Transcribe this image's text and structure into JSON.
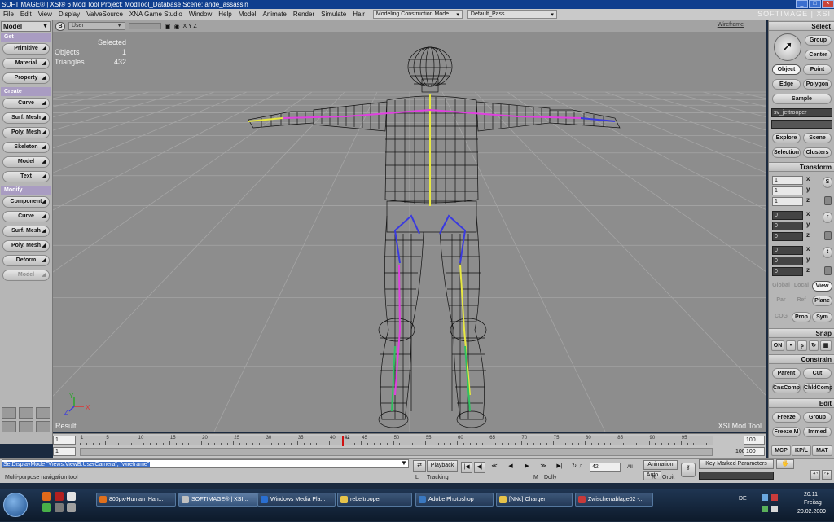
{
  "window": {
    "title": "SOFTIMAGE® | XSI® 6 Mod Tool Project: ModTool_Database    Scene: ande_assassin"
  },
  "menubar": {
    "items": [
      "File",
      "Edit",
      "View",
      "Display",
      "ValveSource",
      "XNA Game Studio",
      "Window",
      "Help",
      "Model",
      "Animate",
      "Render",
      "Simulate",
      "Hair"
    ],
    "mode_select": "Modeling Construction Mode",
    "pass_select": "Default_Pass",
    "brand": "SOFTIMAGE | XSI"
  },
  "left_panel": {
    "title": "Model",
    "sections": [
      {
        "label": "Get",
        "buttons": [
          "Primitive",
          "Material",
          "Property"
        ]
      },
      {
        "label": "Create",
        "buttons": [
          "Curve",
          "Surf. Mesh",
          "Poly. Mesh",
          "Skeleton",
          "Model",
          "Text"
        ]
      },
      {
        "label": "Modify",
        "buttons": [
          "Component",
          "Curve",
          "Surf. Mesh",
          "Poly. Mesh",
          "Deform",
          "Model"
        ]
      }
    ]
  },
  "viewport": {
    "button_b": "B",
    "camera": "User",
    "axes_label": "X Y Z",
    "display_mode": "Wireframe",
    "stats": {
      "selected_label": "Selected",
      "objects_label": "Objects",
      "objects_value": "1",
      "triangles_label": "Triangles",
      "triangles_value": "432"
    },
    "result_label": "Result",
    "tool_label": "XSI Mod Tool",
    "axis_x": "X",
    "axis_y": "Y",
    "axis_z": "Z",
    "colors": {
      "background": "#8d8d8d",
      "grid": "#a5a5a5",
      "wire": "#111111",
      "bone_magenta": "#e040e0",
      "bone_yellow": "#e8e840",
      "bone_blue": "#3a3adf",
      "bone_green": "#30c060"
    }
  },
  "right_panel": {
    "select": {
      "title": "Select",
      "group": "Group",
      "center": "Center",
      "object": "Object",
      "point": "Point",
      "edge": "Edge",
      "polygon": "Polygon",
      "sample": "Sample",
      "name_field": "sv_jettrooper",
      "explore": "Explore",
      "scene": "Scene",
      "selection": "Selection",
      "clusters": "Clusters"
    },
    "transform": {
      "title": "Transform",
      "s_values": [
        "1",
        "1",
        "1"
      ],
      "s_key": "S",
      "r_values": [
        "0",
        "0",
        "0"
      ],
      "r_key": "r",
      "t_values": [
        "0",
        "0",
        "0"
      ],
      "t_key": "t",
      "axes": [
        "x",
        "y",
        "z"
      ],
      "global": "Global",
      "local": "Local",
      "view": "View",
      "par": "Par",
      "ref": "Ref",
      "plane": "Plane",
      "cog": "COG",
      "prop": "Prop",
      "sym": "Sym"
    },
    "snap": {
      "title": "Snap",
      "on": "ON"
    },
    "constrain": {
      "title": "Constrain",
      "parent": "Parent",
      "cut": "Cut",
      "cnscomp": "CnsComp",
      "chldcomp": "ChldComp"
    },
    "edit": {
      "title": "Edit",
      "freeze": "Freeze",
      "group": "Group",
      "freeze_m": "Freeze M",
      "immed": "Immed"
    },
    "tabs": [
      "MCP",
      "KP/L",
      "MAT"
    ]
  },
  "timeline": {
    "start": "1",
    "range_start": "1",
    "end": "100",
    "range_end": "100",
    "current_frame": 42,
    "ticks": [
      "1",
      "5",
      "10",
      "15",
      "20",
      "25",
      "30",
      "35",
      "40",
      "45",
      "50",
      "55",
      "60",
      "65",
      "70",
      "75",
      "80",
      "85",
      "90",
      "95"
    ],
    "right_label": "100"
  },
  "command": {
    "text": "SetDisplayMode \"Views.ViewB.UserCamera\", \"wireframe\"",
    "status": "Multi-purpose navigation tool",
    "playback": "Playback",
    "frame_field": "42",
    "all_label": "All",
    "animation": "Animation",
    "auto": "Auto",
    "key_marked": "Key Marked Parameters",
    "mouse_l": "L",
    "mouse_l_label": "Tracking",
    "mouse_m": "M",
    "mouse_m_label": "Dolly",
    "mouse_r": "R",
    "mouse_r_label": "Orbit"
  },
  "taskbar": {
    "tasks": [
      {
        "label": "800px-Human_Han...",
        "color": "#e0701c"
      },
      {
        "label": "SOFTIMAGE® | XSI...",
        "color": "#c0c0c0"
      },
      {
        "label": "Windows Media Pla...",
        "color": "#2a6fd1"
      },
      {
        "label": "rebeltrooper",
        "color": "#e6c34a"
      },
      {
        "label": "Adobe Photoshop",
        "color": "#3a78c0"
      },
      {
        "label": "[NNc] Charger",
        "color": "#e6c34a"
      },
      {
        "label": "Zwischenablage02 -...",
        "color": "#c73a3a"
      }
    ],
    "lang": "DE",
    "time": "20:11",
    "day": "Freitag",
    "date": "20.02.2009"
  }
}
